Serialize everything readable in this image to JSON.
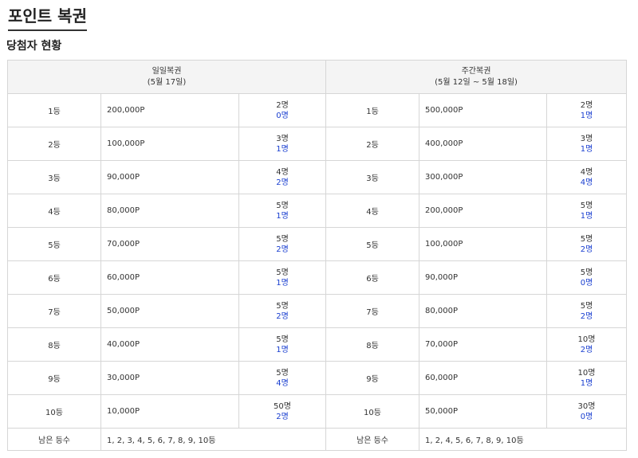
{
  "page_title": "포인트 복권",
  "section_title": "당첨자 현황",
  "daily": {
    "title": "일일복권",
    "period": "(5월 17일)"
  },
  "weekly": {
    "title": "주간복권",
    "period": "(5월 12일 ~ 5월 18일)"
  },
  "rows": [
    {
      "daily": {
        "rank": "1등",
        "prize": "200,000P",
        "total": "2명",
        "winners": "0명"
      },
      "weekly": {
        "rank": "1등",
        "prize": "500,000P",
        "total": "2명",
        "winners": "1명"
      }
    },
    {
      "daily": {
        "rank": "2등",
        "prize": "100,000P",
        "total": "3명",
        "winners": "1명"
      },
      "weekly": {
        "rank": "2등",
        "prize": "400,000P",
        "total": "3명",
        "winners": "1명"
      }
    },
    {
      "daily": {
        "rank": "3등",
        "prize": "90,000P",
        "total": "4명",
        "winners": "2명"
      },
      "weekly": {
        "rank": "3등",
        "prize": "300,000P",
        "total": "4명",
        "winners": "4명"
      }
    },
    {
      "daily": {
        "rank": "4등",
        "prize": "80,000P",
        "total": "5명",
        "winners": "1명"
      },
      "weekly": {
        "rank": "4등",
        "prize": "200,000P",
        "total": "5명",
        "winners": "1명"
      }
    },
    {
      "daily": {
        "rank": "5등",
        "prize": "70,000P",
        "total": "5명",
        "winners": "2명"
      },
      "weekly": {
        "rank": "5등",
        "prize": "100,000P",
        "total": "5명",
        "winners": "2명"
      }
    },
    {
      "daily": {
        "rank": "6등",
        "prize": "60,000P",
        "total": "5명",
        "winners": "1명"
      },
      "weekly": {
        "rank": "6등",
        "prize": "90,000P",
        "total": "5명",
        "winners": "0명"
      }
    },
    {
      "daily": {
        "rank": "7등",
        "prize": "50,000P",
        "total": "5명",
        "winners": "2명"
      },
      "weekly": {
        "rank": "7등",
        "prize": "80,000P",
        "total": "5명",
        "winners": "2명"
      }
    },
    {
      "daily": {
        "rank": "8등",
        "prize": "40,000P",
        "total": "5명",
        "winners": "1명"
      },
      "weekly": {
        "rank": "8등",
        "prize": "70,000P",
        "total": "10명",
        "winners": "2명"
      }
    },
    {
      "daily": {
        "rank": "9등",
        "prize": "30,000P",
        "total": "5명",
        "winners": "4명"
      },
      "weekly": {
        "rank": "9등",
        "prize": "60,000P",
        "total": "10명",
        "winners": "1명"
      }
    },
    {
      "daily": {
        "rank": "10등",
        "prize": "10,000P",
        "total": "50명",
        "winners": "2명"
      },
      "weekly": {
        "rank": "10등",
        "prize": "50,000P",
        "total": "30명",
        "winners": "0명"
      }
    }
  ],
  "remaining": {
    "label": "남은 등수",
    "daily": "1, 2, 3, 4, 5, 6, 7, 8, 9, 10등",
    "weekly": "1, 2, 4, 5, 6, 7, 8, 9, 10등"
  },
  "colors": {
    "winners": "#1a3fd0",
    "header_bg": "#f4f4f4",
    "border": "#d6d6d6"
  }
}
